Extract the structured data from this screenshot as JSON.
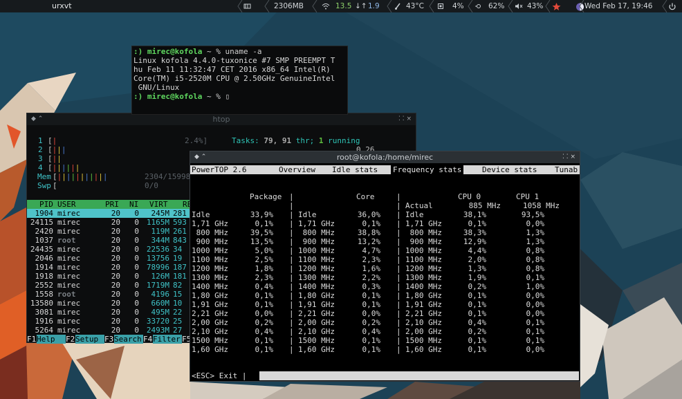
{
  "topbar": {
    "window_title": "urxvt",
    "memory": "2306MB",
    "wifi_down": "13.5",
    "wifi_up": "1.9",
    "temperature": "43°C",
    "cpu": "4%",
    "brightness": "62%",
    "volume": "43%",
    "datetime": "Wed Feb 17, 19:46"
  },
  "uname_term": {
    "prompt_user": ":) mirec@kofola",
    "prompt_tail": " ~ % ",
    "command": "uname -a",
    "output": [
      "Linux kofola 4.4.0-tuxonice #7 SMP PREEMPT T",
      "hu Feb 11 11:32:47 CET 2016 x86_64 Intel(R)",
      "Core(TM) i5-2520M CPU @ 2.50GHz GenuineIntel",
      " GNU/Linux"
    ],
    "cursor": "▯"
  },
  "htop": {
    "title": "htop",
    "meters": [
      {
        "label": "1",
        "bar": "[|",
        "value": "2.4%]"
      },
      {
        "label": "2",
        "bar": "[|||",
        "value": ""
      },
      {
        "label": "3",
        "bar": "[||",
        "value": ""
      },
      {
        "label": "4",
        "bar": "[||||||",
        "value": ""
      },
      {
        "label": "Mem",
        "bar": "[|||||||||||",
        "value": "2304/15998"
      },
      {
        "label": "Swp",
        "bar": "[",
        "value": "0/0"
      }
    ],
    "tasks_label": "Tasks:",
    "tasks_count": "79",
    "threads": "91",
    "thr_label": "thr;",
    "running": "1",
    "running_label": "running",
    "load_value": "0.26",
    "columns": [
      "PID",
      "USER",
      "PRI",
      "NI",
      "VIRT",
      "RES"
    ],
    "processes": [
      {
        "pid": "1904",
        "user": "mirec",
        "pri": "20",
        "ni": "0",
        "virt": "245M",
        "res": "281"
      },
      {
        "pid": "24115",
        "user": "mirec",
        "pri": "20",
        "ni": "0",
        "virt": "1165M",
        "res": "593"
      },
      {
        "pid": "2420",
        "user": "mirec",
        "pri": "20",
        "ni": "0",
        "virt": "119M",
        "res": "261"
      },
      {
        "pid": "1037",
        "user": "root",
        "pri": "20",
        "ni": "0",
        "virt": "344M",
        "res": "843"
      },
      {
        "pid": "24435",
        "user": "mirec",
        "pri": "20",
        "ni": "0",
        "virt": "22536",
        "res": "34"
      },
      {
        "pid": "2046",
        "user": "mirec",
        "pri": "20",
        "ni": "0",
        "virt": "13756",
        "res": "19"
      },
      {
        "pid": "1914",
        "user": "mirec",
        "pri": "20",
        "ni": "0",
        "virt": "78996",
        "res": "187"
      },
      {
        "pid": "1918",
        "user": "mirec",
        "pri": "20",
        "ni": "0",
        "virt": "126M",
        "res": "181"
      },
      {
        "pid": "2552",
        "user": "mirec",
        "pri": "20",
        "ni": "0",
        "virt": "1719M",
        "res": "82"
      },
      {
        "pid": "1558",
        "user": "root",
        "pri": "20",
        "ni": "0",
        "virt": "4196",
        "res": "15"
      },
      {
        "pid": "13580",
        "user": "mirec",
        "pri": "20",
        "ni": "0",
        "virt": "660M",
        "res": "10"
      },
      {
        "pid": "3081",
        "user": "mirec",
        "pri": "20",
        "ni": "0",
        "virt": "495M",
        "res": "22"
      },
      {
        "pid": "1916",
        "user": "mirec",
        "pri": "20",
        "ni": "0",
        "virt": "33720",
        "res": "25"
      },
      {
        "pid": "5264",
        "user": "mirec",
        "pri": "20",
        "ni": "0",
        "virt": "2493M",
        "res": "27"
      }
    ],
    "fkeys": [
      {
        "key": "F1",
        "label": "Help  "
      },
      {
        "key": "F2",
        "label": "Setup "
      },
      {
        "key": "F3",
        "label": "Search"
      },
      {
        "key": "F4",
        "label": "Filter"
      },
      {
        "key": "F5",
        "label": ""
      }
    ]
  },
  "powertop": {
    "window_title": "root@kofola:/home/mirec",
    "app": "PowerTOP 2.6",
    "tabs": [
      "Overview",
      "Idle stats",
      "Frequency stats",
      "Device stats",
      "Tunab"
    ],
    "active_tab": 2,
    "hdr_package": "Package",
    "hdr_core": "Core",
    "hdr_cpu0": "CPU 0",
    "hdr_cpu1": "CPU 1",
    "actual_label": "Actual",
    "actual_cpu0": "885 MHz",
    "actual_cpu1": "1058 MHz",
    "rows": [
      {
        "pk": "Idle",
        "pv": "33,9%",
        "ck": "Idle",
        "cv": "36,0%",
        "xk": "Idle",
        "c0": "38,1%",
        "c1": "93,5%"
      },
      {
        "pk": "1,71 GHz",
        "pv": "0,1%",
        "ck": "1,71 GHz",
        "cv": "0,1%",
        "xk": "1,71 GHz",
        "c0": "0,1%",
        "c1": "0,0%"
      },
      {
        "pk": " 800 MHz",
        "pv": "39,5%",
        "ck": " 800 MHz",
        "cv": "38,8%",
        "xk": " 800 MHz",
        "c0": "38,3%",
        "c1": "1,3%"
      },
      {
        "pk": " 900 MHz",
        "pv": "13,5%",
        "ck": " 900 MHz",
        "cv": "13,2%",
        "xk": " 900 MHz",
        "c0": "12,9%",
        "c1": "1,3%"
      },
      {
        "pk": "1000 MHz",
        "pv": "5,0%",
        "ck": "1000 MHz",
        "cv": "4,7%",
        "xk": "1000 MHz",
        "c0": "4,4%",
        "c1": "0,8%"
      },
      {
        "pk": "1100 MHz",
        "pv": "2,5%",
        "ck": "1100 MHz",
        "cv": "2,3%",
        "xk": "1100 MHz",
        "c0": "2,0%",
        "c1": "0,8%"
      },
      {
        "pk": "1200 MHz",
        "pv": "1,8%",
        "ck": "1200 MHz",
        "cv": "1,6%",
        "xk": "1200 MHz",
        "c0": "1,3%",
        "c1": "0,8%"
      },
      {
        "pk": "1300 MHz",
        "pv": "2,3%",
        "ck": "1300 MHz",
        "cv": "2,2%",
        "xk": "1300 MHz",
        "c0": "1,9%",
        "c1": "0,1%"
      },
      {
        "pk": "1400 MHz",
        "pv": "0,4%",
        "ck": "1400 MHz",
        "cv": "0,3%",
        "xk": "1400 MHz",
        "c0": "0,2%",
        "c1": "1,0%"
      },
      {
        "pk": "1,80 GHz",
        "pv": "0,1%",
        "ck": "1,80 GHz",
        "cv": "0,1%",
        "xk": "1,80 GHz",
        "c0": "0,1%",
        "c1": "0,0%"
      },
      {
        "pk": "1,91 GHz",
        "pv": "0,1%",
        "ck": "1,91 GHz",
        "cv": "0,1%",
        "xk": "1,91 GHz",
        "c0": "0,1%",
        "c1": "0,0%"
      },
      {
        "pk": "2,21 GHz",
        "pv": "0,0%",
        "ck": "2,21 GHz",
        "cv": "0,0%",
        "xk": "2,21 GHz",
        "c0": "0,1%",
        "c1": "0,0%"
      },
      {
        "pk": "2,00 GHz",
        "pv": "0,2%",
        "ck": "2,00 GHz",
        "cv": "0,2%",
        "xk": "2,10 GHz",
        "c0": "0,4%",
        "c1": "0,1%"
      },
      {
        "pk": "2,10 GHz",
        "pv": "0,4%",
        "ck": "2,10 GHz",
        "cv": "0,4%",
        "xk": "2,00 GHz",
        "c0": "0,2%",
        "c1": "0,1%"
      },
      {
        "pk": "1500 MHz",
        "pv": "0,1%",
        "ck": "1500 MHz",
        "cv": "0,1%",
        "xk": "1500 MHz",
        "c0": "0,1%",
        "c1": "0,1%"
      },
      {
        "pk": "1,60 GHz",
        "pv": "0,1%",
        "ck": "1,60 GHz",
        "cv": "0,1%",
        "xk": "1,60 GHz",
        "c0": "0,1%",
        "c1": "0,0%"
      }
    ],
    "footer": "<ESC> Exit |"
  }
}
